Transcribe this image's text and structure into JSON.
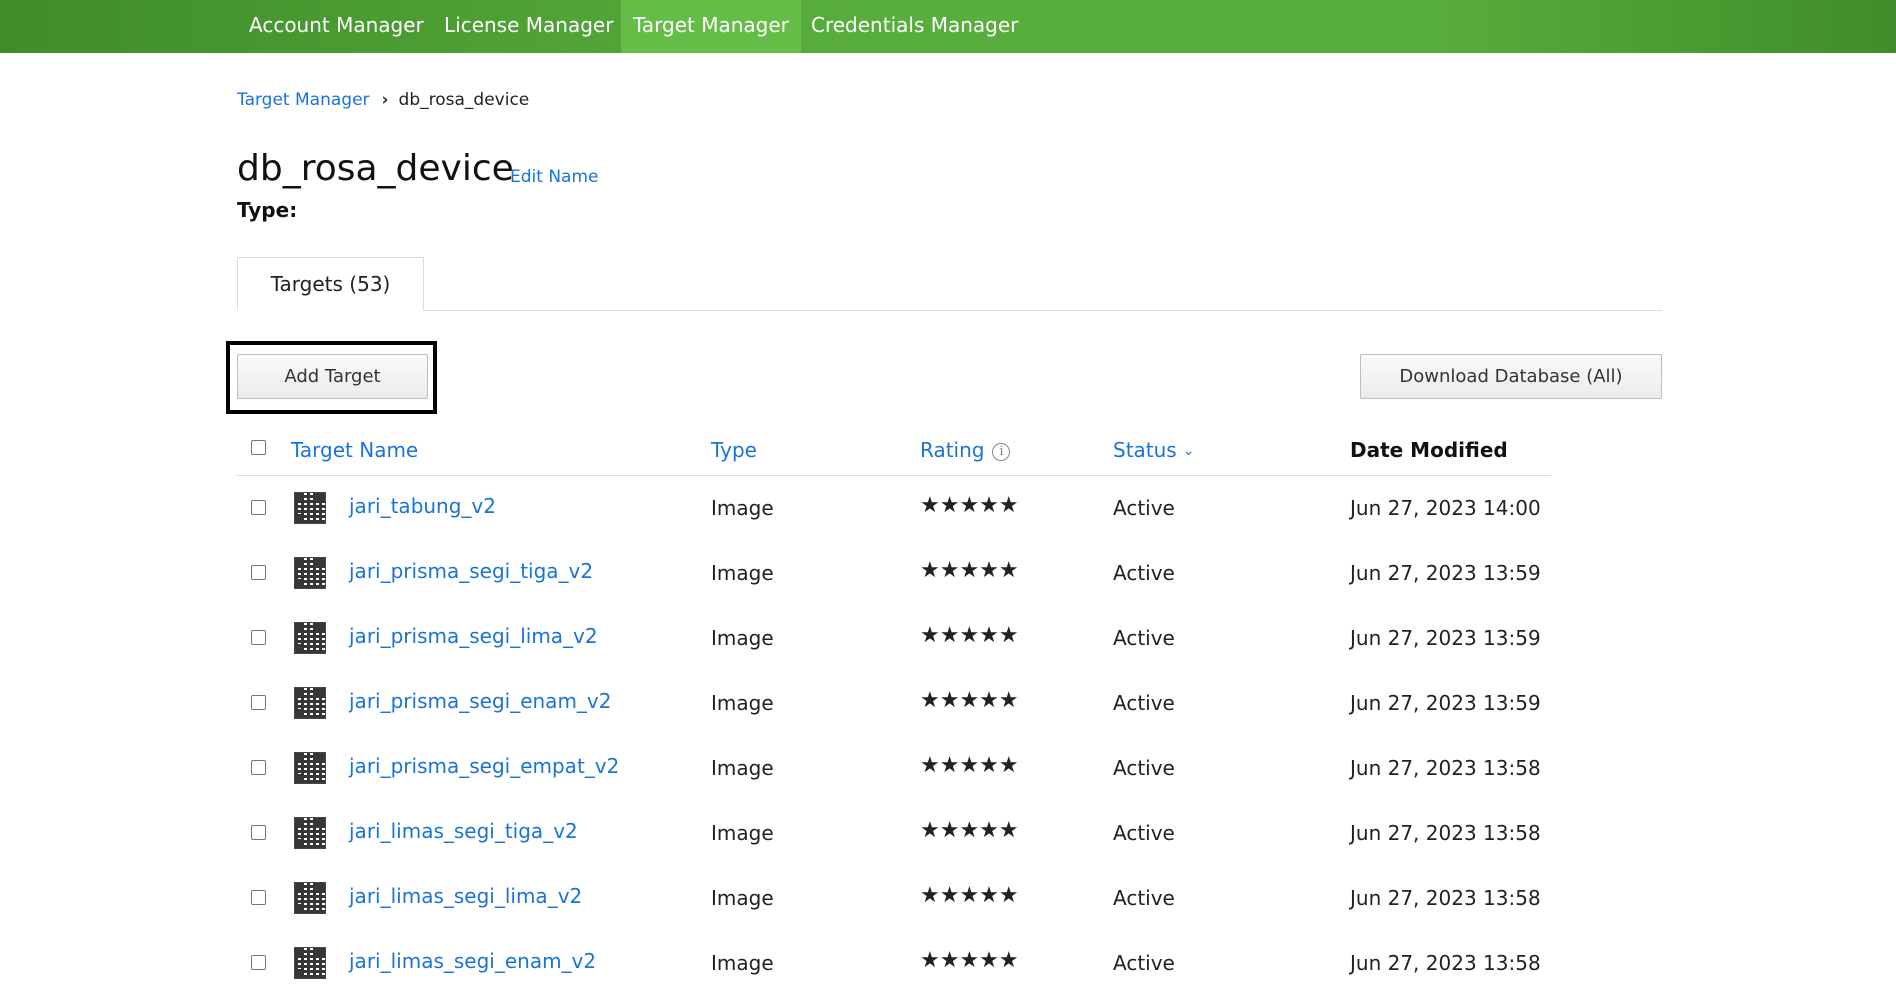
{
  "nav": {
    "items": [
      {
        "label": "Account Manager"
      },
      {
        "label": "License Manager"
      },
      {
        "label": "Target Manager",
        "active": true
      },
      {
        "label": "Credentials Manager"
      }
    ],
    "color": "#4ea332"
  },
  "breadcrumb": {
    "parent": "Target Manager",
    "separator": "›",
    "current": "db_rosa_device"
  },
  "page": {
    "title": "db_rosa_device",
    "edit_name": "Edit Name",
    "type_label": "Type:"
  },
  "tabs": [
    {
      "label": "Targets (53)",
      "active": true
    }
  ],
  "buttons": {
    "add_target": "Add Target",
    "download_database": "Download Database (All)"
  },
  "table": {
    "headers": {
      "target_name": "Target Name",
      "type": "Type",
      "rating": "Rating",
      "status": "Status",
      "date_modified": "Date Modified"
    },
    "rows": [
      {
        "name": "jari_tabung_v2",
        "type": "Image",
        "rating": 5,
        "status": "Active",
        "date": "Jun 27, 2023 14:00"
      },
      {
        "name": "jari_prisma_segi_tiga_v2",
        "type": "Image",
        "rating": 5,
        "status": "Active",
        "date": "Jun 27, 2023 13:59"
      },
      {
        "name": "jari_prisma_segi_lima_v2",
        "type": "Image",
        "rating": 5,
        "status": "Active",
        "date": "Jun 27, 2023 13:59"
      },
      {
        "name": "jari_prisma_segi_enam_v2",
        "type": "Image",
        "rating": 5,
        "status": "Active",
        "date": "Jun 27, 2023 13:59"
      },
      {
        "name": "jari_prisma_segi_empat_v2",
        "type": "Image",
        "rating": 5,
        "status": "Active",
        "date": "Jun 27, 2023 13:58"
      },
      {
        "name": "jari_limas_segi_tiga_v2",
        "type": "Image",
        "rating": 5,
        "status": "Active",
        "date": "Jun 27, 2023 13:58"
      },
      {
        "name": "jari_limas_segi_lima_v2",
        "type": "Image",
        "rating": 5,
        "status": "Active",
        "date": "Jun 27, 2023 13:58"
      },
      {
        "name": "jari_limas_segi_enam_v2",
        "type": "Image",
        "rating": 5,
        "status": "Active",
        "date": "Jun 27, 2023 13:58"
      }
    ]
  },
  "colors": {
    "link": "#1a73d8",
    "star": "#f5b600"
  }
}
